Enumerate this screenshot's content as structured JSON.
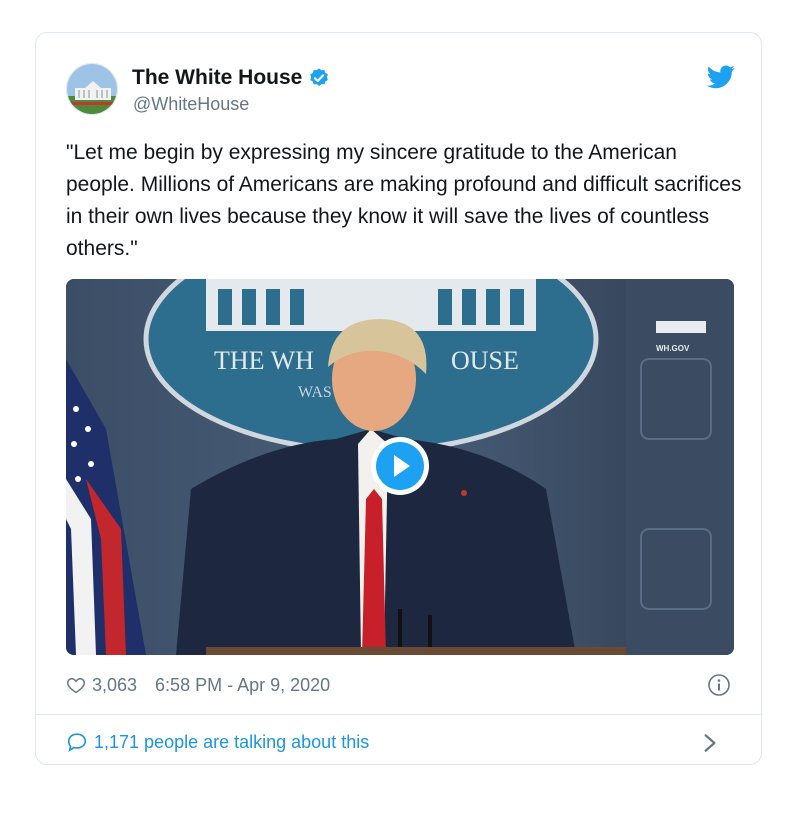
{
  "tweet": {
    "display_name": "The White House",
    "handle": "@WhiteHouse",
    "verified": true,
    "text": "\"Let me begin by expressing my sincere gratitude to the American people. Millions of Americans are making profound and difficult sacrifices in their own lives because they know it will save the lives of countless others.\"",
    "likes": "3,063",
    "timestamp": "6:58 PM - Apr 9, 2020",
    "talking": "1,171 people are talking about this"
  },
  "media": {
    "backdrop_text": "THE WHITE HOUSE",
    "backdrop_sub": "WAS",
    "watermark": "WH.GOV"
  },
  "colors": {
    "accent": "#1da1f2",
    "link": "#1b95e0",
    "muted": "#657786",
    "border": "#e1e8ed"
  },
  "icons": [
    "twitter-bird-icon",
    "verified-badge-icon",
    "heart-icon",
    "info-icon",
    "reply-icon",
    "chevron-right-icon",
    "play-icon"
  ]
}
